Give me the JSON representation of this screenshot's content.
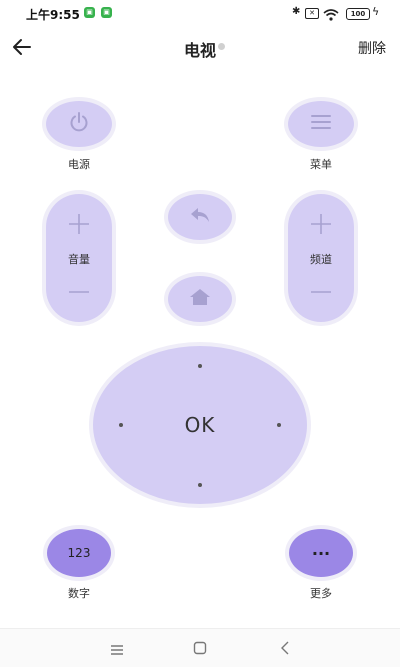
{
  "status_bar": {
    "time": "上午9:55",
    "notif_badge_1": "□",
    "notif_badge_2": "□",
    "battery": "100"
  },
  "header": {
    "title": "电视",
    "delete_label": "删除"
  },
  "buttons": {
    "power_label": "电源",
    "menu_label": "菜单",
    "volume_label": "音量",
    "channel_label": "频道",
    "ok_label": "OK",
    "number_text": "123",
    "number_label": "数字",
    "more_text": "···",
    "more_label": "更多"
  },
  "colors": {
    "button_fill": "#d4cdf4",
    "button_ring": "#efedf8",
    "accent_dark": "#9b87e6",
    "icon_muted": "#a7a1d0"
  }
}
